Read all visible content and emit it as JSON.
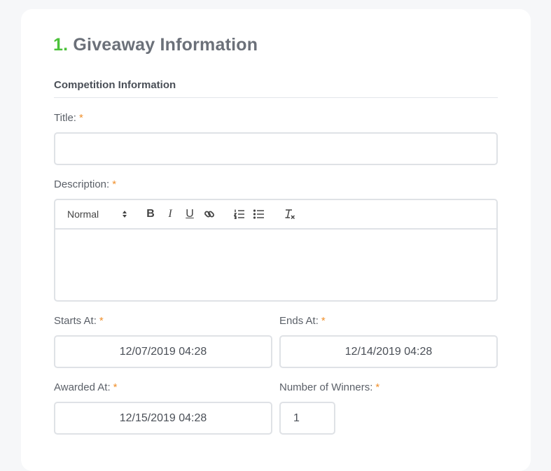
{
  "section": {
    "number": "1.",
    "title": "Giveaway Information"
  },
  "subsection_title": "Competition Information",
  "required_marker": "*",
  "fields": {
    "title": {
      "label": "Title:",
      "value": ""
    },
    "description": {
      "label": "Description:",
      "format_select": "Normal",
      "toolbar": {
        "bold": "B",
        "italic": "I",
        "underline": "U"
      }
    },
    "starts_at": {
      "label": "Starts At:",
      "value": "12/07/2019 04:28"
    },
    "ends_at": {
      "label": "Ends At:",
      "value": "12/14/2019 04:28"
    },
    "awarded_at": {
      "label": "Awarded At:",
      "value": "12/15/2019 04:28"
    },
    "winners": {
      "label": "Number of Winners:",
      "value": "1"
    }
  },
  "icons": {
    "link": "link-icon",
    "ordered_list": "ordered-list-icon",
    "bullet_list": "bullet-list-icon",
    "clear_format": "clear-format-icon",
    "select_arrows": "sort-arrows-icon"
  },
  "colors": {
    "accent_green": "#4cc23a",
    "required_orange": "#f0902c",
    "border": "#dfe2e6"
  }
}
